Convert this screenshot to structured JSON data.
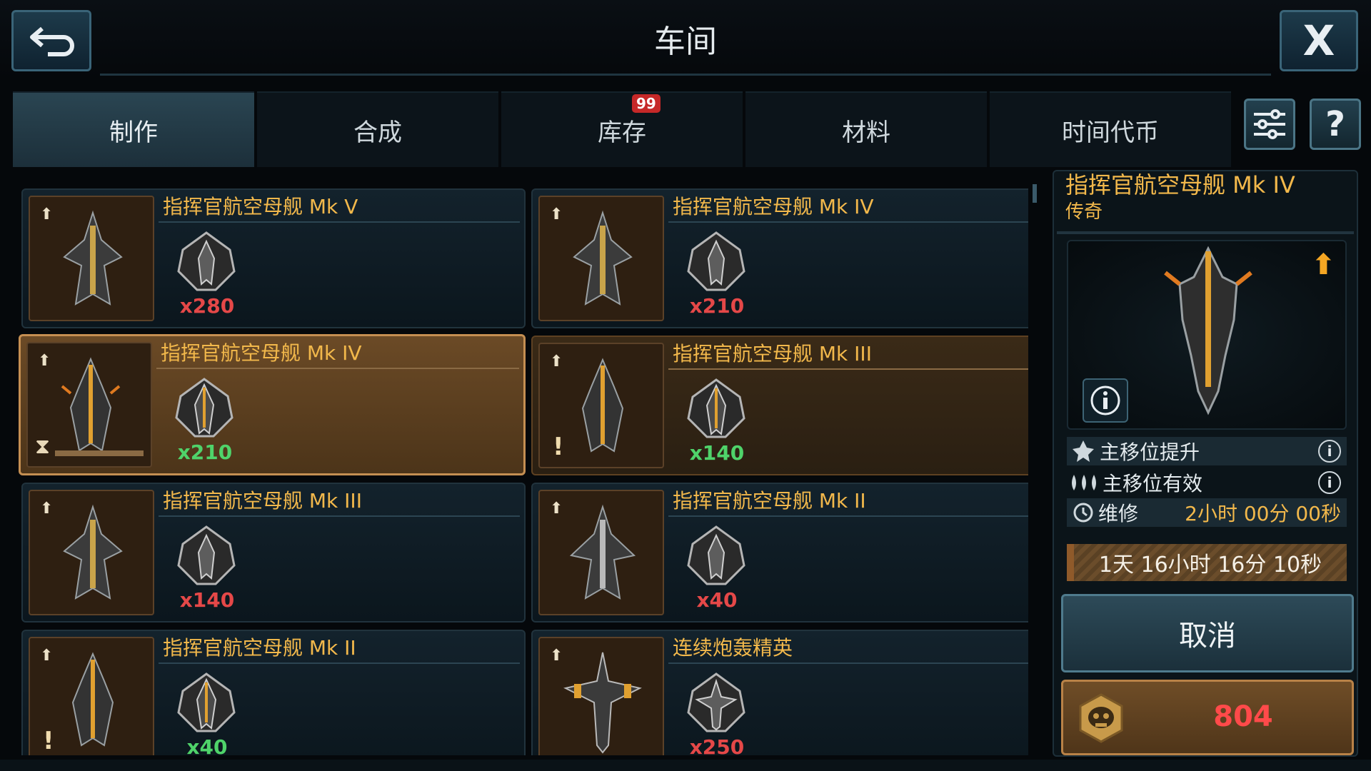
{
  "header": {
    "title": "车间",
    "close_label": "X"
  },
  "tabs": [
    {
      "label": "制作",
      "active": true
    },
    {
      "label": "合成"
    },
    {
      "label": "库存",
      "badge": "99"
    },
    {
      "label": "材料"
    },
    {
      "label": "时间代币"
    }
  ],
  "toolbar": {
    "help_label": "?"
  },
  "cards": [
    {
      "name": "指挥官航空母舰 Mk V",
      "count": "x280",
      "count_color": "red",
      "state": "normal"
    },
    {
      "name": "指挥官航空母舰 Mk IV",
      "count": "x210",
      "count_color": "red",
      "state": "normal"
    },
    {
      "name": "指挥官航空母舰 Mk IV",
      "count": "x210",
      "count_color": "green",
      "state": "selected"
    },
    {
      "name": "指挥官航空母舰 Mk III",
      "count": "x140",
      "count_color": "green",
      "state": "ready"
    },
    {
      "name": "指挥官航空母舰 Mk III",
      "count": "x140",
      "count_color": "red",
      "state": "normal"
    },
    {
      "name": "指挥官航空母舰 Mk II",
      "count": "x40",
      "count_color": "red",
      "state": "normal"
    },
    {
      "name": "指挥官航空母舰 Mk II",
      "count": "x40",
      "count_color": "green",
      "state": "normal"
    },
    {
      "name": "连续炮轰精英",
      "count": "x250",
      "count_color": "red",
      "state": "normal"
    }
  ],
  "detail": {
    "title": "指挥官航空母舰 Mk IV",
    "rarity": "传奇",
    "stats": [
      {
        "label": "主移位提升"
      },
      {
        "label": "主移位有效"
      },
      {
        "label": "维修",
        "value": "2小时 00分 00秒"
      }
    ],
    "timer": "1天 16小时 16分 10秒",
    "cancel_label": "取消",
    "cost": "804"
  },
  "colors": {
    "accent_gold": "#f2b84b",
    "cost_red": "#ff4a4a",
    "count_green": "#4fd36a",
    "count_red": "#e54848"
  }
}
